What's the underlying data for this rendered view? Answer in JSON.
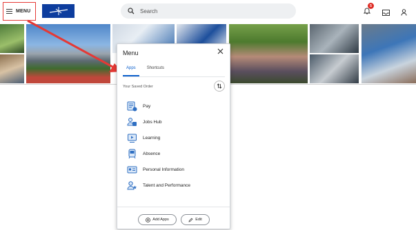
{
  "header": {
    "menu_label": "MENU",
    "search_placeholder": "Search",
    "notification_count": "5"
  },
  "menu_panel": {
    "title": "Menu",
    "tabs": [
      {
        "label": "Apps",
        "active": true
      },
      {
        "label": "Shortcuts",
        "active": false
      }
    ],
    "saved_order_label": "Your Saved Order",
    "apps": [
      {
        "label": "Pay",
        "icon": "pay-icon"
      },
      {
        "label": "Jobs Hub",
        "icon": "jobs-hub-icon"
      },
      {
        "label": "Learning",
        "icon": "learning-icon"
      },
      {
        "label": "Absence",
        "icon": "absence-icon"
      },
      {
        "label": "Personal Information",
        "icon": "personal-information-icon"
      },
      {
        "label": "Talent and Performance",
        "icon": "talent-icon"
      }
    ],
    "add_apps_label": "Add Apps",
    "edit_label": "Edit"
  },
  "colors": {
    "accent": "#0b5fcc",
    "brand": "#0d3d9e",
    "highlight": "#e53935",
    "badge": "#de2d26"
  }
}
